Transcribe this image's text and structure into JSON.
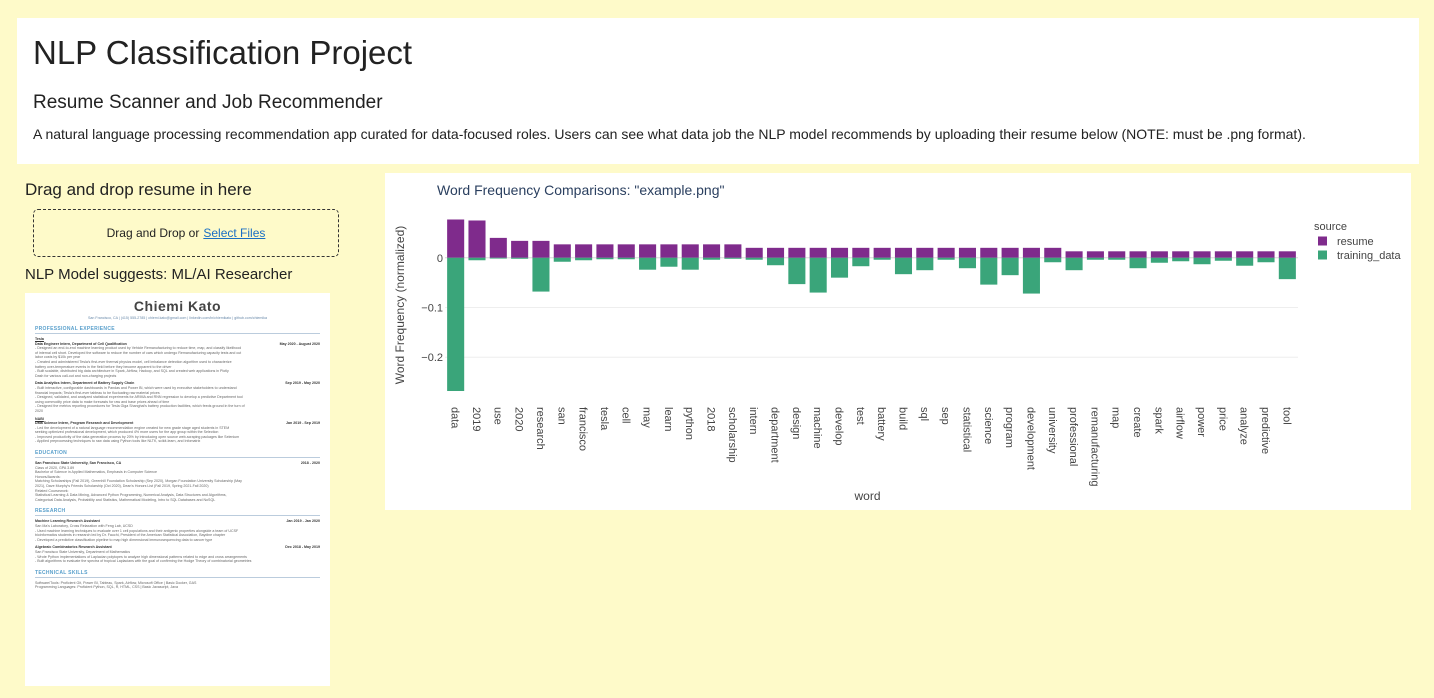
{
  "header": {
    "title": "NLP Classification Project",
    "subtitle": "Resume Scanner and Job Recommender",
    "description": "A natural language processing recommendation app curated for data-focused roles. Users can see what data job the NLP model recommends by uploading their resume below (NOTE: must be .png format)."
  },
  "upload": {
    "heading": "Drag and drop resume in here",
    "prompt": "Drag and Drop or",
    "link": "Select Files"
  },
  "suggestion": "NLP Model suggests: ML/AI Researcher",
  "resume": {
    "name": "Chiemi Kato",
    "contact": "San Francisco, CA | (415) 555-2785 | chiemi.kato@gmail.com | linkedin.com/in/chiemikato | github.com/chiemika",
    "sections": [
      {
        "heading": "PROFESSIONAL EXPERIENCE",
        "entries": [
          {
            "org": "Tesla",
            "role": "Data Engineer Intern, Department of Cell Qualification",
            "date": "May 2020 - August 2020",
            "lines": [
              "- Designed an end-to-end machine learning product used by Vehicle Remanufacturing to reduce time, map, and classify likelihood",
              "of internal cell short. Developed the software to reduce the number of cars which undergo Remanufacturing capacity tests and cut",
              "labor costs by $10k per year",
              "- Created and administered Tesla's first-ever thermal physics model, cell imbalance detection algorithm used to characterize",
              "battery over-temperature events in the field before they become apparent to the driver",
              "- Built scalable, distributed big data architecture in Spark, Airflow, Hadoop, and SQL and created web applications in Plotly",
              "Dash for various call-out and non-charging projects"
            ]
          },
          {
            "org": "",
            "role": "Data Analytics Intern, Department of Battery Supply Chain",
            "date": "Sep 2019 - May 2020",
            "lines": [
              "- Built interactive, configurable dashboards in Pandas and Power BI, which were used by executive stakeholders to understand",
              "financial impacts; Tesla's first-ever tableau to be fluctuating raw material prices",
              "- Designed, validated, and analyzed statistical experiments for ARIMA and RNN regression to develop a predictive Department tool",
              "using commodity price data to make forecasts for raw and base prices ahead of time",
              "- Designed the metrics reporting procedures for Tesla Giga Shanghai's battery production facilities, which feeds ground in the turn of",
              "2020"
            ]
          },
          {
            "org": "NABI",
            "role": "Data Science Intern, Program Research and Development",
            "date": "Jan 2019 - Sep 2019",
            "lines": [
              "- Led the development of a natural language recommendation engine created for new grade stage aged students in STEM",
              "seeking optimized professional development, which produced 4% more users for the app group within the Selection",
              "- Improved productivity of the data generation process by 20% by introducing open source web-scraping packages like Selenium",
              "- Applied preprocessing techniques to raw data using Python tools like NLTK, scikit-learn, and Infomatrix"
            ]
          }
        ]
      },
      {
        "heading": "EDUCATION",
        "entries": [
          {
            "org": "",
            "role": "San Francisco State University, San Francisco, CA",
            "date": "2018 - 2020",
            "lines": [
              "Class of 2020, GPA 3.89",
              "Bachelor of Science in Applied Mathematics, Emphasis in Computer Science",
              "Honors/Awards:",
              "Matching Scholarships (Fall 2019), Greenhill Foundation Scholarship (Sep 2020), Morgan Foundation University Scholarship (May",
              "2021), Dave Murphy's Friends Scholarship (Oct 2020), Dean's Honors List (Fall 2019, Spring 2021-Fall 2020)",
              "Related Coursework:",
              "Statistical Learning & Data Mining, Advanced Python Programming, Numerical Analysis, Data Structures and Algorithms,",
              "Categorical Data Analysis, Probability and Statistics, Mathematical Modeling, Intro to SQL Databases and NoSQL"
            ]
          }
        ]
      },
      {
        "heading": "RESEARCH",
        "entries": [
          {
            "org": "",
            "role": "Machine Learning Research Assistant",
            "date": "Jan 2019 - Jan 2020",
            "lines": [
              "San Ma's Laboratory, Cross Relaxation with Feng Lab, UCSD",
              "- Used machine learning techniques to evaluate over 1 cell populations and their antigenic properties alongside a team of UCSF",
              "bioinformatics students in research led by Dr. Fauchi, President of the American Statistical Association, Baydine chapter",
              "- Developed a predictive classification pipeline to map high dimensional immunosequencing data to cancer type"
            ]
          },
          {
            "org": "",
            "role": "Algebraic Combinatorics Research Assistant",
            "date": "Dec 2018 - May 2019",
            "lines": [
              "San Francisco State University, Department of Mathematics",
              "- Wrote Python implementations of Laplacian polytopes to analyze high dimensional patterns related to edge and cross arrangements",
              "- Built algorithms to evaluate the spectra of tropical Laplacians with the goal of confirming the Hodge Theory of combinatorial geometries"
            ]
          }
        ]
      },
      {
        "heading": "TECHNICAL SKILLS",
        "entries": [
          {
            "org": "",
            "role": "",
            "date": "",
            "lines": [
              "Software/Tools: Proficient Git, Power BI, Tableau, Spark, Airflow, Microsoft Office | Basic Docker, GAS",
              "Programming Languages: Proficient Python, SQL, R, HTML, CSS | Basic Javascript, Java"
            ]
          }
        ]
      }
    ]
  },
  "chart_data": {
    "type": "bar",
    "title": "Word Frequency Comparisons: \"example.png\"",
    "xlabel": "word",
    "ylabel": "Word Frequency (normalized)",
    "ylim": [
      -0.27,
      0.08
    ],
    "yticks": [
      0,
      -0.1,
      -0.2
    ],
    "ytick_labels": [
      "0",
      "−0.1",
      "−0.2"
    ],
    "legend_title": "source",
    "legend_position": "top-right",
    "grid": true,
    "categories": [
      "data",
      "2019",
      "use",
      "2020",
      "research",
      "san",
      "francisco",
      "tesla",
      "cell",
      "may",
      "learn",
      "python",
      "2018",
      "scholarship",
      "intern",
      "department",
      "design",
      "machine",
      "develop",
      "test",
      "battery",
      "build",
      "sql",
      "sep",
      "statistical",
      "science",
      "program",
      "development",
      "university",
      "professional",
      "remanufacturing",
      "map",
      "create",
      "spark",
      "airflow",
      "power",
      "price",
      "analyze",
      "predictive",
      "tool"
    ],
    "series": [
      {
        "name": "resume",
        "color": "#7f2b8c",
        "values": [
          0.077,
          0.075,
          0.04,
          0.034,
          0.034,
          0.027,
          0.027,
          0.027,
          0.027,
          0.027,
          0.027,
          0.027,
          0.027,
          0.027,
          0.02,
          0.02,
          0.02,
          0.02,
          0.02,
          0.02,
          0.02,
          0.02,
          0.02,
          0.02,
          0.02,
          0.02,
          0.02,
          0.02,
          0.02,
          0.013,
          0.013,
          0.013,
          0.013,
          0.013,
          0.013,
          0.013,
          0.013,
          0.013,
          0.013,
          0.013
        ]
      },
      {
        "name": "training_data",
        "color": "#3aa57a",
        "values": [
          -0.268,
          -0.005,
          -0.001,
          -0.002,
          -0.068,
          -0.008,
          -0.005,
          -0.003,
          -0.003,
          -0.024,
          -0.018,
          -0.024,
          -0.004,
          -0.002,
          -0.004,
          -0.015,
          -0.053,
          -0.07,
          -0.04,
          -0.017,
          -0.004,
          -0.033,
          -0.025,
          -0.004,
          -0.021,
          -0.054,
          -0.035,
          -0.072,
          -0.009,
          -0.025,
          -0.004,
          -0.004,
          -0.021,
          -0.01,
          -0.007,
          -0.013,
          -0.006,
          -0.016,
          -0.009,
          -0.043
        ]
      }
    ]
  }
}
